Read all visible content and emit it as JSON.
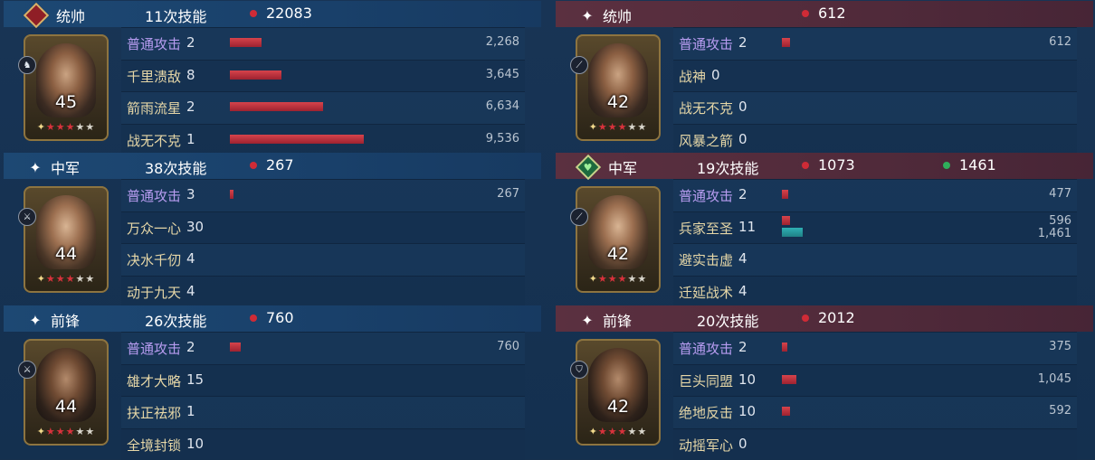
{
  "left": [
    {
      "role": "统帅",
      "role_icon": "flag-diamond-icon",
      "skill_count": "11次技能",
      "damage": "22083",
      "level": "45",
      "badge_icon": "cavalry-icon",
      "skills": [
        {
          "name": "普通攻击",
          "count": "2",
          "value": "2,268",
          "ratio": 0.238
        },
        {
          "name": "千里溃敌",
          "count": "8",
          "value": "3,645",
          "ratio": 0.382
        },
        {
          "name": "箭雨流星",
          "count": "2",
          "value": "6,634",
          "ratio": 0.696
        },
        {
          "name": "战无不克",
          "count": "1",
          "value": "9,536",
          "ratio": 1.0
        }
      ]
    },
    {
      "role": "中军",
      "role_icon": "spark-icon",
      "skill_count": "38次技能",
      "damage": "267",
      "level": "44",
      "badge_icon": "infantry-icon",
      "skills": [
        {
          "name": "普通攻击",
          "count": "3",
          "value": "267",
          "ratio": 0.028
        },
        {
          "name": "万众一心",
          "count": "30",
          "value": "",
          "ratio": 0
        },
        {
          "name": "决水千仞",
          "count": "4",
          "value": "",
          "ratio": 0
        },
        {
          "name": "动于九天",
          "count": "4",
          "value": "",
          "ratio": 0
        }
      ]
    },
    {
      "role": "前锋",
      "role_icon": "spark-icon",
      "skill_count": "26次技能",
      "damage": "760",
      "level": "44",
      "badge_icon": "infantry-icon",
      "skills": [
        {
          "name": "普通攻击",
          "count": "2",
          "value": "760",
          "ratio": 0.08
        },
        {
          "name": "雄才大略",
          "count": "15",
          "value": "",
          "ratio": 0
        },
        {
          "name": "扶正祛邪",
          "count": "1",
          "value": "",
          "ratio": 0
        },
        {
          "name": "全境封锁",
          "count": "10",
          "value": "",
          "ratio": 0
        }
      ]
    }
  ],
  "right": [
    {
      "role": "统帅",
      "role_icon": "spark-icon",
      "skill_count": "",
      "damage": "612",
      "level": "42",
      "badge_icon": "spear-icon",
      "skills": [
        {
          "name": "普通攻击",
          "count": "2",
          "value": "612",
          "ratio": 0.064
        },
        {
          "name": "战神",
          "count": "0",
          "value": "",
          "ratio": 0
        },
        {
          "name": "战无不克",
          "count": "0",
          "value": "",
          "ratio": 0
        },
        {
          "name": "风暴之箭",
          "count": "0",
          "value": "",
          "ratio": 0
        }
      ]
    },
    {
      "role": "中军",
      "role_icon": "heart-diamond-icon",
      "skill_count": "19次技能",
      "damage": "1073",
      "heal": "1461",
      "level": "42",
      "badge_icon": "spear-icon",
      "skills": [
        {
          "name": "普通攻击",
          "count": "2",
          "value": "477",
          "ratio": 0.05
        },
        {
          "name": "兵家至圣",
          "count": "11",
          "value": "596",
          "value2": "1,461",
          "ratio": 0.063,
          "ratio2": 0.153
        },
        {
          "name": "避实击虚",
          "count": "4",
          "value": "",
          "ratio": 0
        },
        {
          "name": "迁延战术",
          "count": "4",
          "value": "",
          "ratio": 0
        }
      ]
    },
    {
      "role": "前锋",
      "role_icon": "spark-icon",
      "skill_count": "20次技能",
      "damage": "2012",
      "level": "42",
      "badge_icon": "shield-icon",
      "skills": [
        {
          "name": "普通攻击",
          "count": "2",
          "value": "375",
          "ratio": 0.039
        },
        {
          "name": "巨头同盟",
          "count": "10",
          "value": "1,045",
          "ratio": 0.11
        },
        {
          "name": "绝地反击",
          "count": "10",
          "value": "592",
          "ratio": 0.062
        },
        {
          "name": "动摇军心",
          "count": "0",
          "value": "",
          "ratio": 0
        }
      ]
    }
  ],
  "colors": {
    "damage": "#cf2b36",
    "heal": "#2fae5b",
    "basic_attack": "#b79cf0",
    "skill_name": "#e6d7a7"
  }
}
